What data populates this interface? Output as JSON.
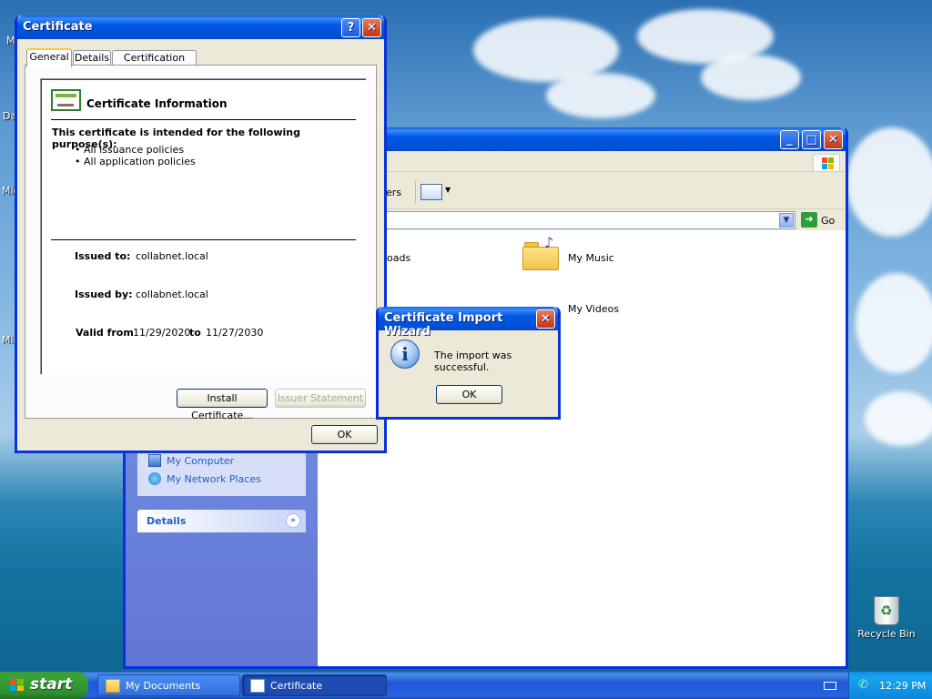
{
  "desktop": {
    "partial_labels": [
      "M",
      "Da",
      "Mic",
      "Mic"
    ],
    "recycle_bin_label": "Recycle Bin"
  },
  "certificate_dialog": {
    "title": "Certificate",
    "help_glyph": "?",
    "close_glyph": "✕",
    "tabs": [
      {
        "label": "General",
        "active": true
      },
      {
        "label": "Details",
        "active": false
      },
      {
        "label": "Certification Path",
        "active": false
      }
    ],
    "info_heading": "Certificate Information",
    "purpose_heading": "This certificate is intended for the following purpose(s):",
    "purposes": [
      "• All issuance policies",
      "• All application policies"
    ],
    "issued_to_label": "Issued to:",
    "issued_to_value": "collabnet.local",
    "issued_by_label": "Issued by:",
    "issued_by_value": "collabnet.local",
    "valid_from_label": "Valid from",
    "valid_from_value": "11/29/2020",
    "valid_to_label": "to",
    "valid_to_value": "11/27/2030",
    "install_button": "Install Certificate...",
    "issuer_statement_button": "Issuer Statement",
    "ok_button": "OK"
  },
  "import_wizard": {
    "title": "Certificate Import Wizard",
    "close_glyph": "✕",
    "message": "The import was successful.",
    "ok_button": "OK"
  },
  "explorer": {
    "min_glyph": "_",
    "max_glyph": "□",
    "close_glyph": "✕",
    "toolbar_partial": "lders",
    "go_button": "Go",
    "items": [
      {
        "label": "nloads"
      },
      {
        "label": "My Music"
      },
      {
        "label": "My Videos"
      }
    ],
    "other_places": [
      "My Computer",
      "My Network Places"
    ],
    "details_header": "Details"
  },
  "taskbar": {
    "start_label": "start",
    "tasks": [
      "My Documents",
      "Certificate"
    ],
    "clock": "12:29 PM"
  },
  "colors": {
    "xp_blue": "#0831d9",
    "start_green": "#37a337",
    "dialog_face": "#ece9d8"
  }
}
